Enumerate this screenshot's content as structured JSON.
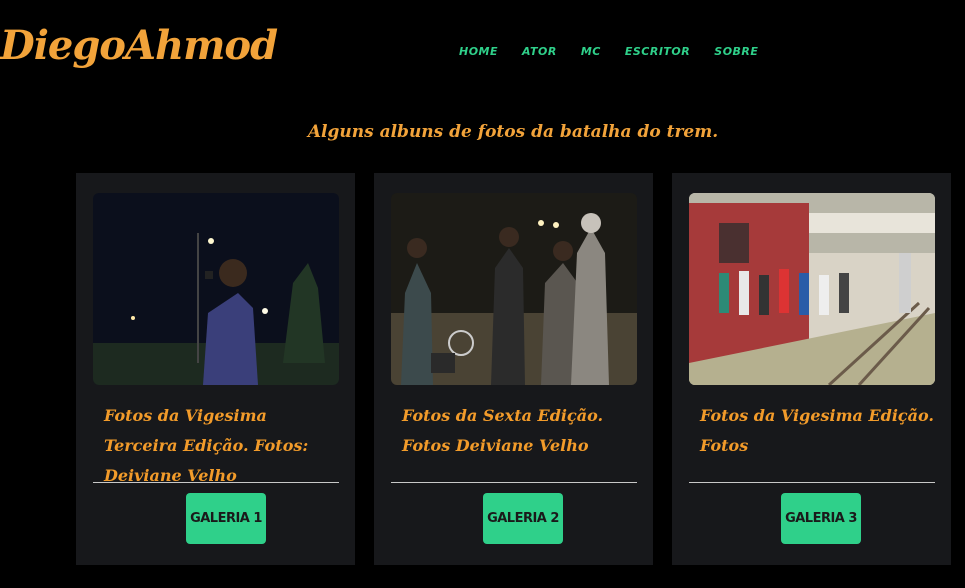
{
  "header": {
    "logo": "DiegoAhmod",
    "nav": [
      "HOME",
      "ATOR",
      "MC",
      "ESCRITOR",
      "SOBRE"
    ]
  },
  "main": {
    "subtitle": "Alguns albuns de fotos da batalha do trem.",
    "cards": [
      {
        "title": "Fotos da Vigesima Terceira Edição. Fotos: Deiviane Velho",
        "button": "GALERIA 1"
      },
      {
        "title": "Fotos da Sexta Edição. Fotos Deiviane Velho",
        "button": "GALERIA 2"
      },
      {
        "title": "Fotos da Vigesima Edição. Fotos",
        "button": "GALERIA 3"
      }
    ]
  },
  "colors": {
    "accent": "#2fd08a",
    "orange": "#f2a33a",
    "card": "#17181b"
  }
}
